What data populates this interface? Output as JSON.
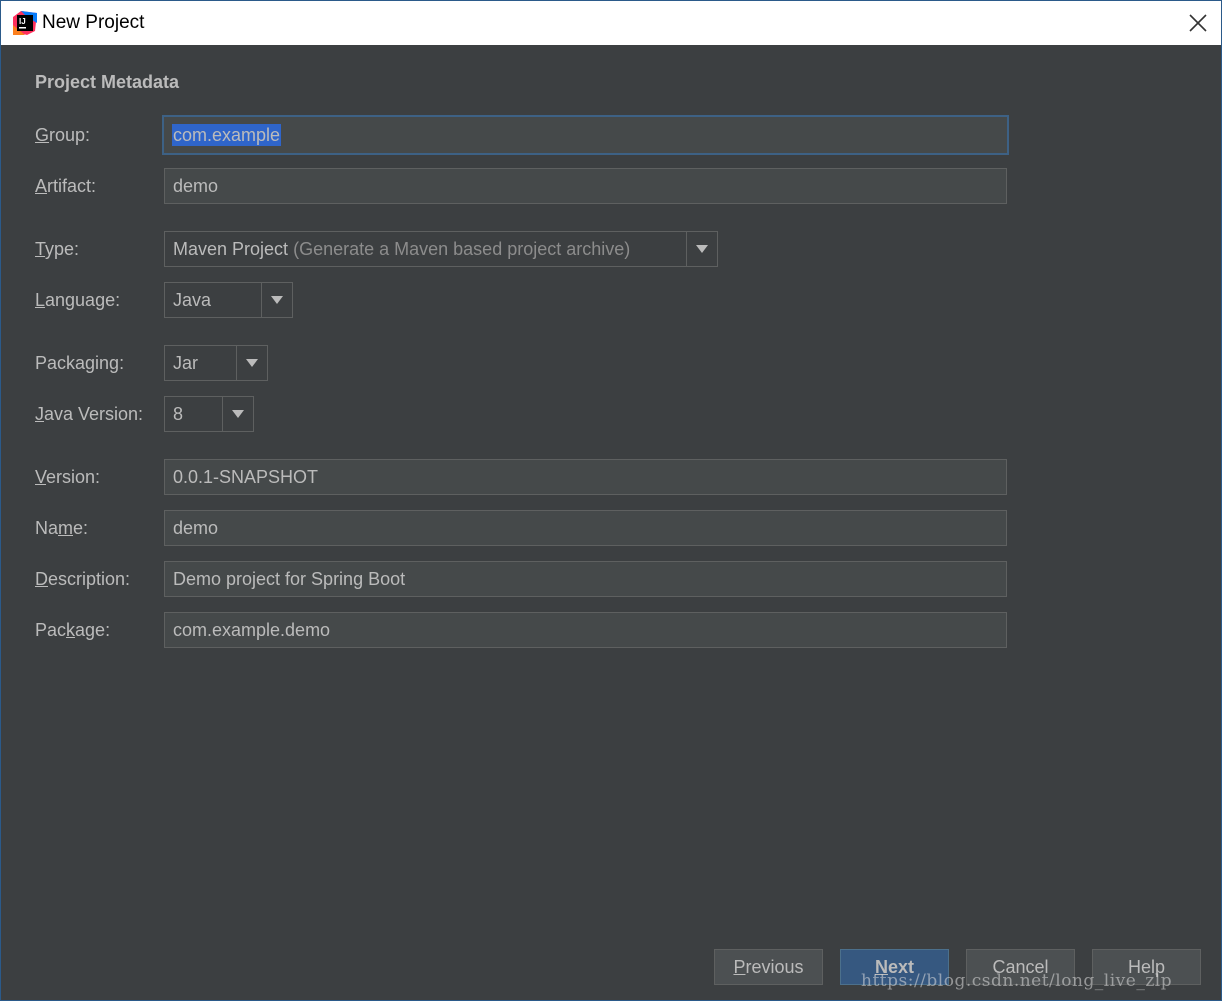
{
  "window": {
    "title": "New Project"
  },
  "section": {
    "title": "Project Metadata"
  },
  "fields": {
    "group": {
      "label": "Group:",
      "value": "com.example"
    },
    "artifact": {
      "label": "Artifact:",
      "value": "demo"
    },
    "type": {
      "label": "Type:",
      "value": "Maven Project",
      "hint": "(Generate a Maven based project archive)"
    },
    "language": {
      "label": "Language:",
      "value": "Java"
    },
    "packaging": {
      "label": "Packaging:",
      "value": "Jar"
    },
    "java_version": {
      "label": "Java Version:",
      "value": "8"
    },
    "version": {
      "label": "Version:",
      "value": "0.0.1-SNAPSHOT"
    },
    "name": {
      "label": "Name:",
      "value": "demo"
    },
    "description": {
      "label": "Description:",
      "value": "Demo project for Spring Boot"
    },
    "package": {
      "label": "Package:",
      "value": "com.example.demo"
    }
  },
  "buttons": {
    "previous": "Previous",
    "next": "Next",
    "cancel": "Cancel",
    "help": "Help"
  },
  "watermark": "https://blog.csdn.net/long_live_zlp",
  "colors": {
    "background": "#3c3f41",
    "field_bg": "#45494a",
    "text": "#bbbbbb",
    "selection": "#2f65ca",
    "primary_button": "#365880"
  }
}
